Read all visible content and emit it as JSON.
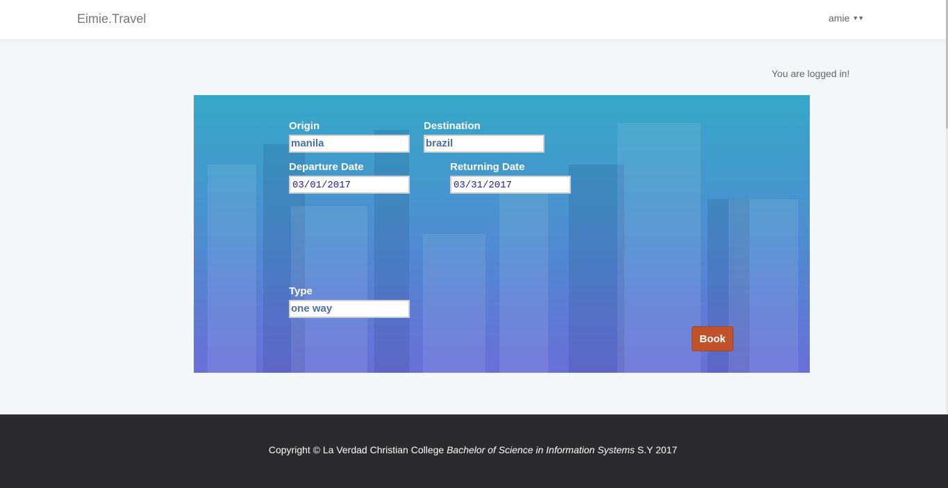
{
  "navbar": {
    "brand": "Eimie.Travel",
    "user": "amie"
  },
  "status": {
    "logged_in": "You are logged in!"
  },
  "form": {
    "origin_label": "Origin",
    "origin_value": "manila",
    "destination_label": "Destination",
    "destination_value": "brazil",
    "departure_label": "Departure Date",
    "departure_value": "03/01/2017",
    "returning_label": "Returning Date",
    "returning_value": "03/31/2017",
    "type_label": "Type",
    "type_value": "one way",
    "book_label": "Book"
  },
  "footer": {
    "prefix": "Copyright © La Verdad Christian College",
    "program": "Bachelor of Science in Information Systems",
    "suffix": "S.Y 2017"
  },
  "colors": {
    "book_button": "#c0532b",
    "footer_bg": "#2a2b2e",
    "panel_top": "#35a8c8",
    "panel_bottom": "#6a6fd8"
  }
}
